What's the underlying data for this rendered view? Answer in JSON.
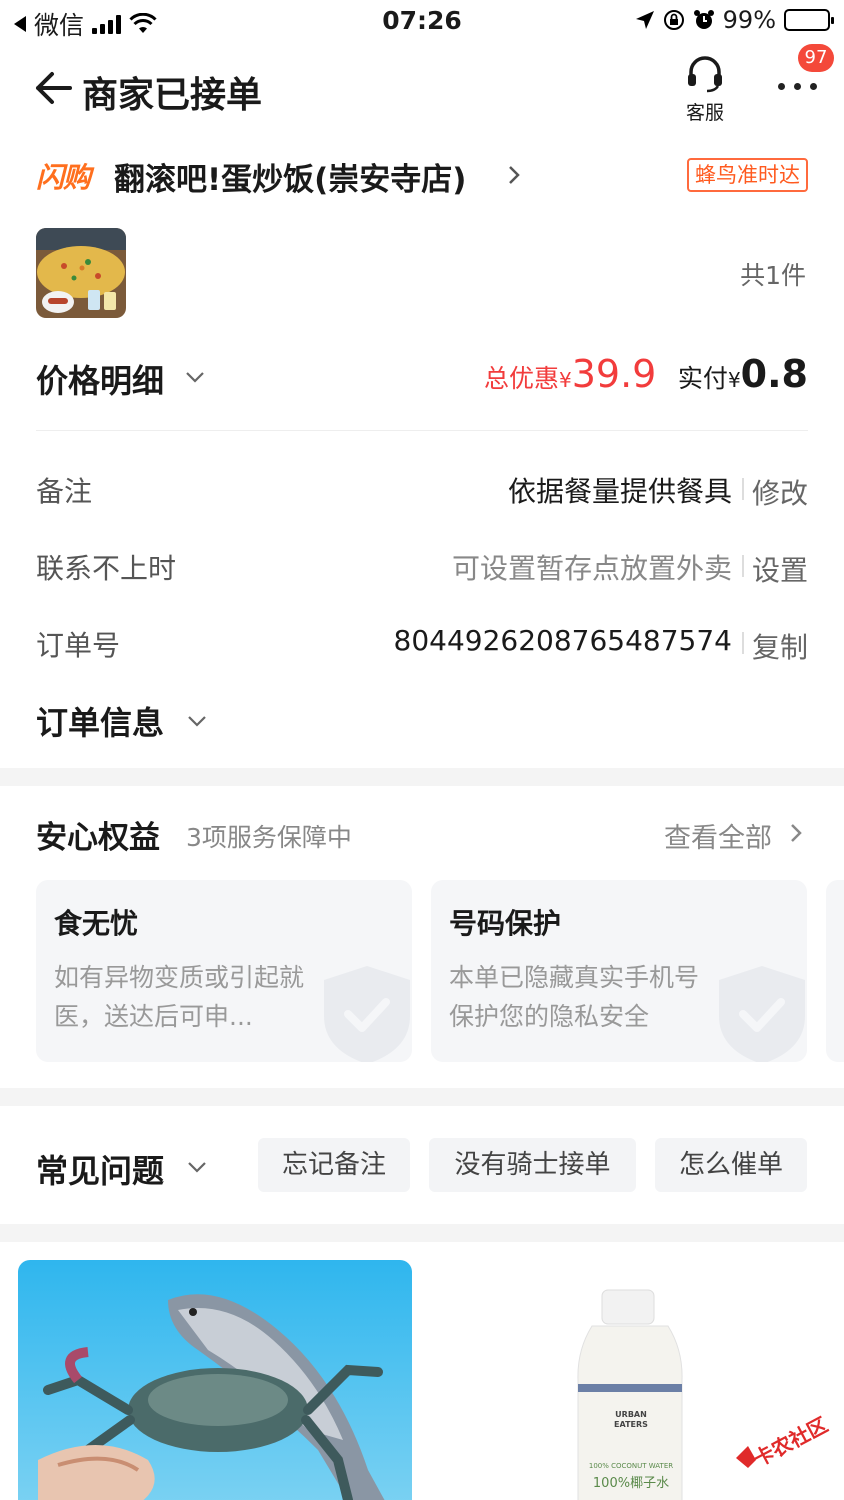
{
  "status_bar": {
    "carrier": "微信",
    "time": "07:26",
    "battery": "99%"
  },
  "header": {
    "title": "商家已接单",
    "customer_service_label": "客服",
    "badge_count": "97"
  },
  "store": {
    "brand_tag": "闪购",
    "name": "翻滚吧!蛋炒饭(崇安寺店)",
    "delivery_tag": "蜂鸟准时达"
  },
  "order_items": {
    "count_label": "共1件"
  },
  "price": {
    "label": "价格明细",
    "discount_label": "总优惠",
    "discount_currency": "¥",
    "discount_value": "39.9",
    "paid_label": "实付",
    "paid_currency": "¥",
    "paid_value": "0.8"
  },
  "info_rows": {
    "remark": {
      "label": "备注",
      "value": "依据餐量提供餐具",
      "action": "修改"
    },
    "unreachable": {
      "label": "联系不上时",
      "value": "可设置暂存点放置外卖",
      "action": "设置"
    },
    "order_no": {
      "label": "订单号",
      "value": "8044926208765487574",
      "action": "复制"
    },
    "order_info_label": "订单信息"
  },
  "guarantee": {
    "title": "安心权益",
    "subtitle": "3项服务保障中",
    "view_all": "查看全部",
    "cards": [
      {
        "title": "食无忧",
        "desc": "如有异物变质或引起就医，送达后可申..."
      },
      {
        "title": "号码保护",
        "desc": "本单已隐藏真实手机号保护您的隐私安全"
      }
    ]
  },
  "faq": {
    "title": "常见问题",
    "chips": [
      "忘记备注",
      "没有骑士接单",
      "怎么催单"
    ]
  },
  "recommend": {
    "bottle_brand": "URBAN EATERS",
    "bottle_label_en": "100% COCONUT WATER",
    "bottle_label_cn": "100%椰子水"
  },
  "watermark": "卡农社区",
  "colors": {
    "accent_red": "#f23c3c",
    "accent_orange": "#ff6f1e",
    "badge_red": "#f4493a"
  }
}
